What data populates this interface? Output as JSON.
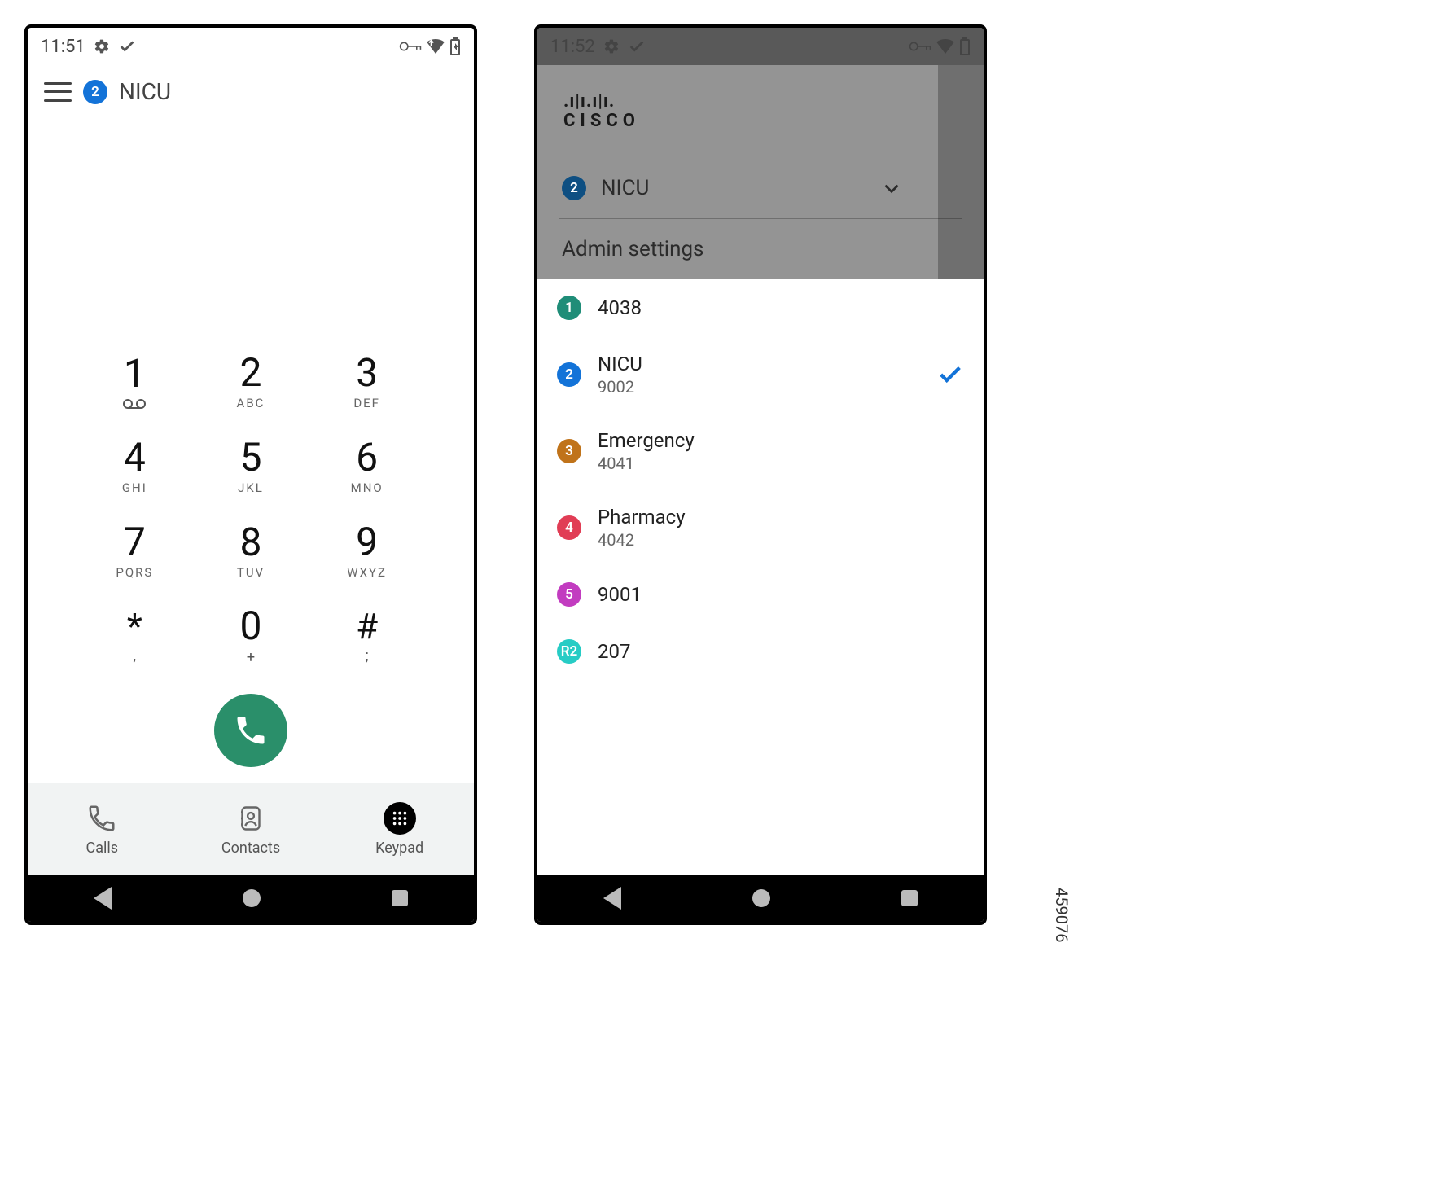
{
  "watermark": "459076",
  "screen1": {
    "status": {
      "time": "11:51"
    },
    "header": {
      "badge": "2",
      "label": "NICU"
    },
    "keys": {
      "k1": {
        "digit": "1",
        "letters": ""
      },
      "k2": {
        "digit": "2",
        "letters": "ABC"
      },
      "k3": {
        "digit": "3",
        "letters": "DEF"
      },
      "k4": {
        "digit": "4",
        "letters": "GHI"
      },
      "k5": {
        "digit": "5",
        "letters": "JKL"
      },
      "k6": {
        "digit": "6",
        "letters": "MNO"
      },
      "k7": {
        "digit": "7",
        "letters": "PQRS"
      },
      "k8": {
        "digit": "8",
        "letters": "TUV"
      },
      "k9": {
        "digit": "9",
        "letters": "WXYZ"
      },
      "kstar": {
        "sym": "*",
        "sub": ","
      },
      "k0": {
        "digit": "0",
        "sub": "+"
      },
      "khash": {
        "sym": "#",
        "sub": ";"
      }
    },
    "tabs": {
      "calls": "Calls",
      "contacts": "Contacts",
      "keypad": "Keypad"
    }
  },
  "screen2": {
    "status": {
      "time": "11:52"
    },
    "logo": {
      "bars": ".ı|ı.ı|ı.",
      "text": "CISCO"
    },
    "current": {
      "badge": "2",
      "label": "NICU"
    },
    "admin_label": "Admin settings",
    "lines": [
      {
        "badge": "1",
        "color": "bg-bluegrn",
        "name": "4038",
        "num": "",
        "selected": false
      },
      {
        "badge": "2",
        "color": "bg-blue",
        "name": "NICU",
        "num": "9002",
        "selected": true
      },
      {
        "badge": "3",
        "color": "bg-brown",
        "name": "Emergency",
        "num": "4041",
        "selected": false
      },
      {
        "badge": "4",
        "color": "bg-red",
        "name": "Pharmacy",
        "num": "4042",
        "selected": false
      },
      {
        "badge": "5",
        "color": "bg-magenta",
        "name": "9001",
        "num": "",
        "selected": false
      },
      {
        "badge": "R2",
        "color": "bg-teal",
        "name": "207",
        "num": "",
        "selected": false
      }
    ]
  }
}
